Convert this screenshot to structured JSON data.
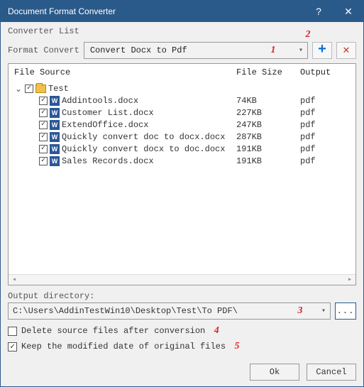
{
  "window": {
    "title": "Document Format Converter"
  },
  "labels": {
    "converter_list": "Converter List",
    "format_convert": "Format Convert",
    "output_directory": "Output directory:",
    "delete_source": "Delete source files after conversion",
    "keep_date": "Keep the modified date of original files"
  },
  "format_select": {
    "value": "Convert Docx to Pdf"
  },
  "columns": {
    "file_source": "File Source",
    "file_size": "File Size",
    "output": "Output"
  },
  "root": {
    "name": "Test"
  },
  "files": [
    {
      "name": "Addintools.docx",
      "size": "74KB",
      "output": "pdf"
    },
    {
      "name": "Customer List.docx",
      "size": "227KB",
      "output": "pdf"
    },
    {
      "name": "ExtendOffice.docx",
      "size": "247KB",
      "output": "pdf"
    },
    {
      "name": "Quickly convert doc to docx.docx",
      "size": "287KB",
      "output": "pdf"
    },
    {
      "name": "Quickly convert docx to doc.docx",
      "size": "191KB",
      "output": "pdf"
    },
    {
      "name": "Sales Records.docx",
      "size": "191KB",
      "output": "pdf"
    }
  ],
  "output_path": "C:\\Users\\AddinTestWin10\\Desktop\\Test\\To PDF\\",
  "checks": {
    "delete_source": false,
    "keep_date": true
  },
  "buttons": {
    "ok": "Ok",
    "cancel": "Cancel"
  },
  "callouts": {
    "c1": "1",
    "c2": "2",
    "c3": "3",
    "c4": "4",
    "c5": "5"
  }
}
